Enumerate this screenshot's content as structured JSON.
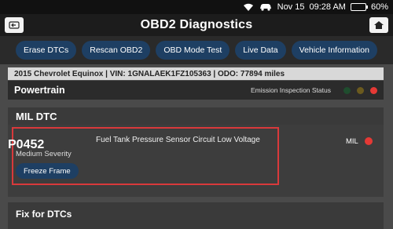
{
  "status_bar": {
    "date": "Nov 15",
    "time": "09:28 AM",
    "battery": "60%",
    "battery_level": 0.6
  },
  "header": {
    "title": "OBD2 Diagnostics"
  },
  "actions": [
    {
      "label": "Erase DTCs"
    },
    {
      "label": "Rescan OBD2"
    },
    {
      "label": "OBD Mode Test"
    },
    {
      "label": "Live Data"
    },
    {
      "label": "Vehicle Information"
    }
  ],
  "vehicle": {
    "info": "2015 Chevrolet Equinox | VIN: 1GNALAEK1FZ105363 | ODO: 77894 miles"
  },
  "powertrain": {
    "title": "Powertrain",
    "emission_label": "Emission Inspection Status",
    "status_colors": [
      "#1f4d2e",
      "#6b5a1e",
      "#e53935"
    ]
  },
  "mil": {
    "section_title": "MIL DTC",
    "code": "P0452",
    "severity": "Medium Severity",
    "description": "Fuel Tank Pressure Sensor Circuit Low Voltage",
    "freeze_frame_label": "Freeze Frame",
    "mil_label": "MIL",
    "mil_color": "#e53935",
    "highlight_color": "#d9393b"
  },
  "fix": {
    "title": "Fix for DTCs"
  }
}
